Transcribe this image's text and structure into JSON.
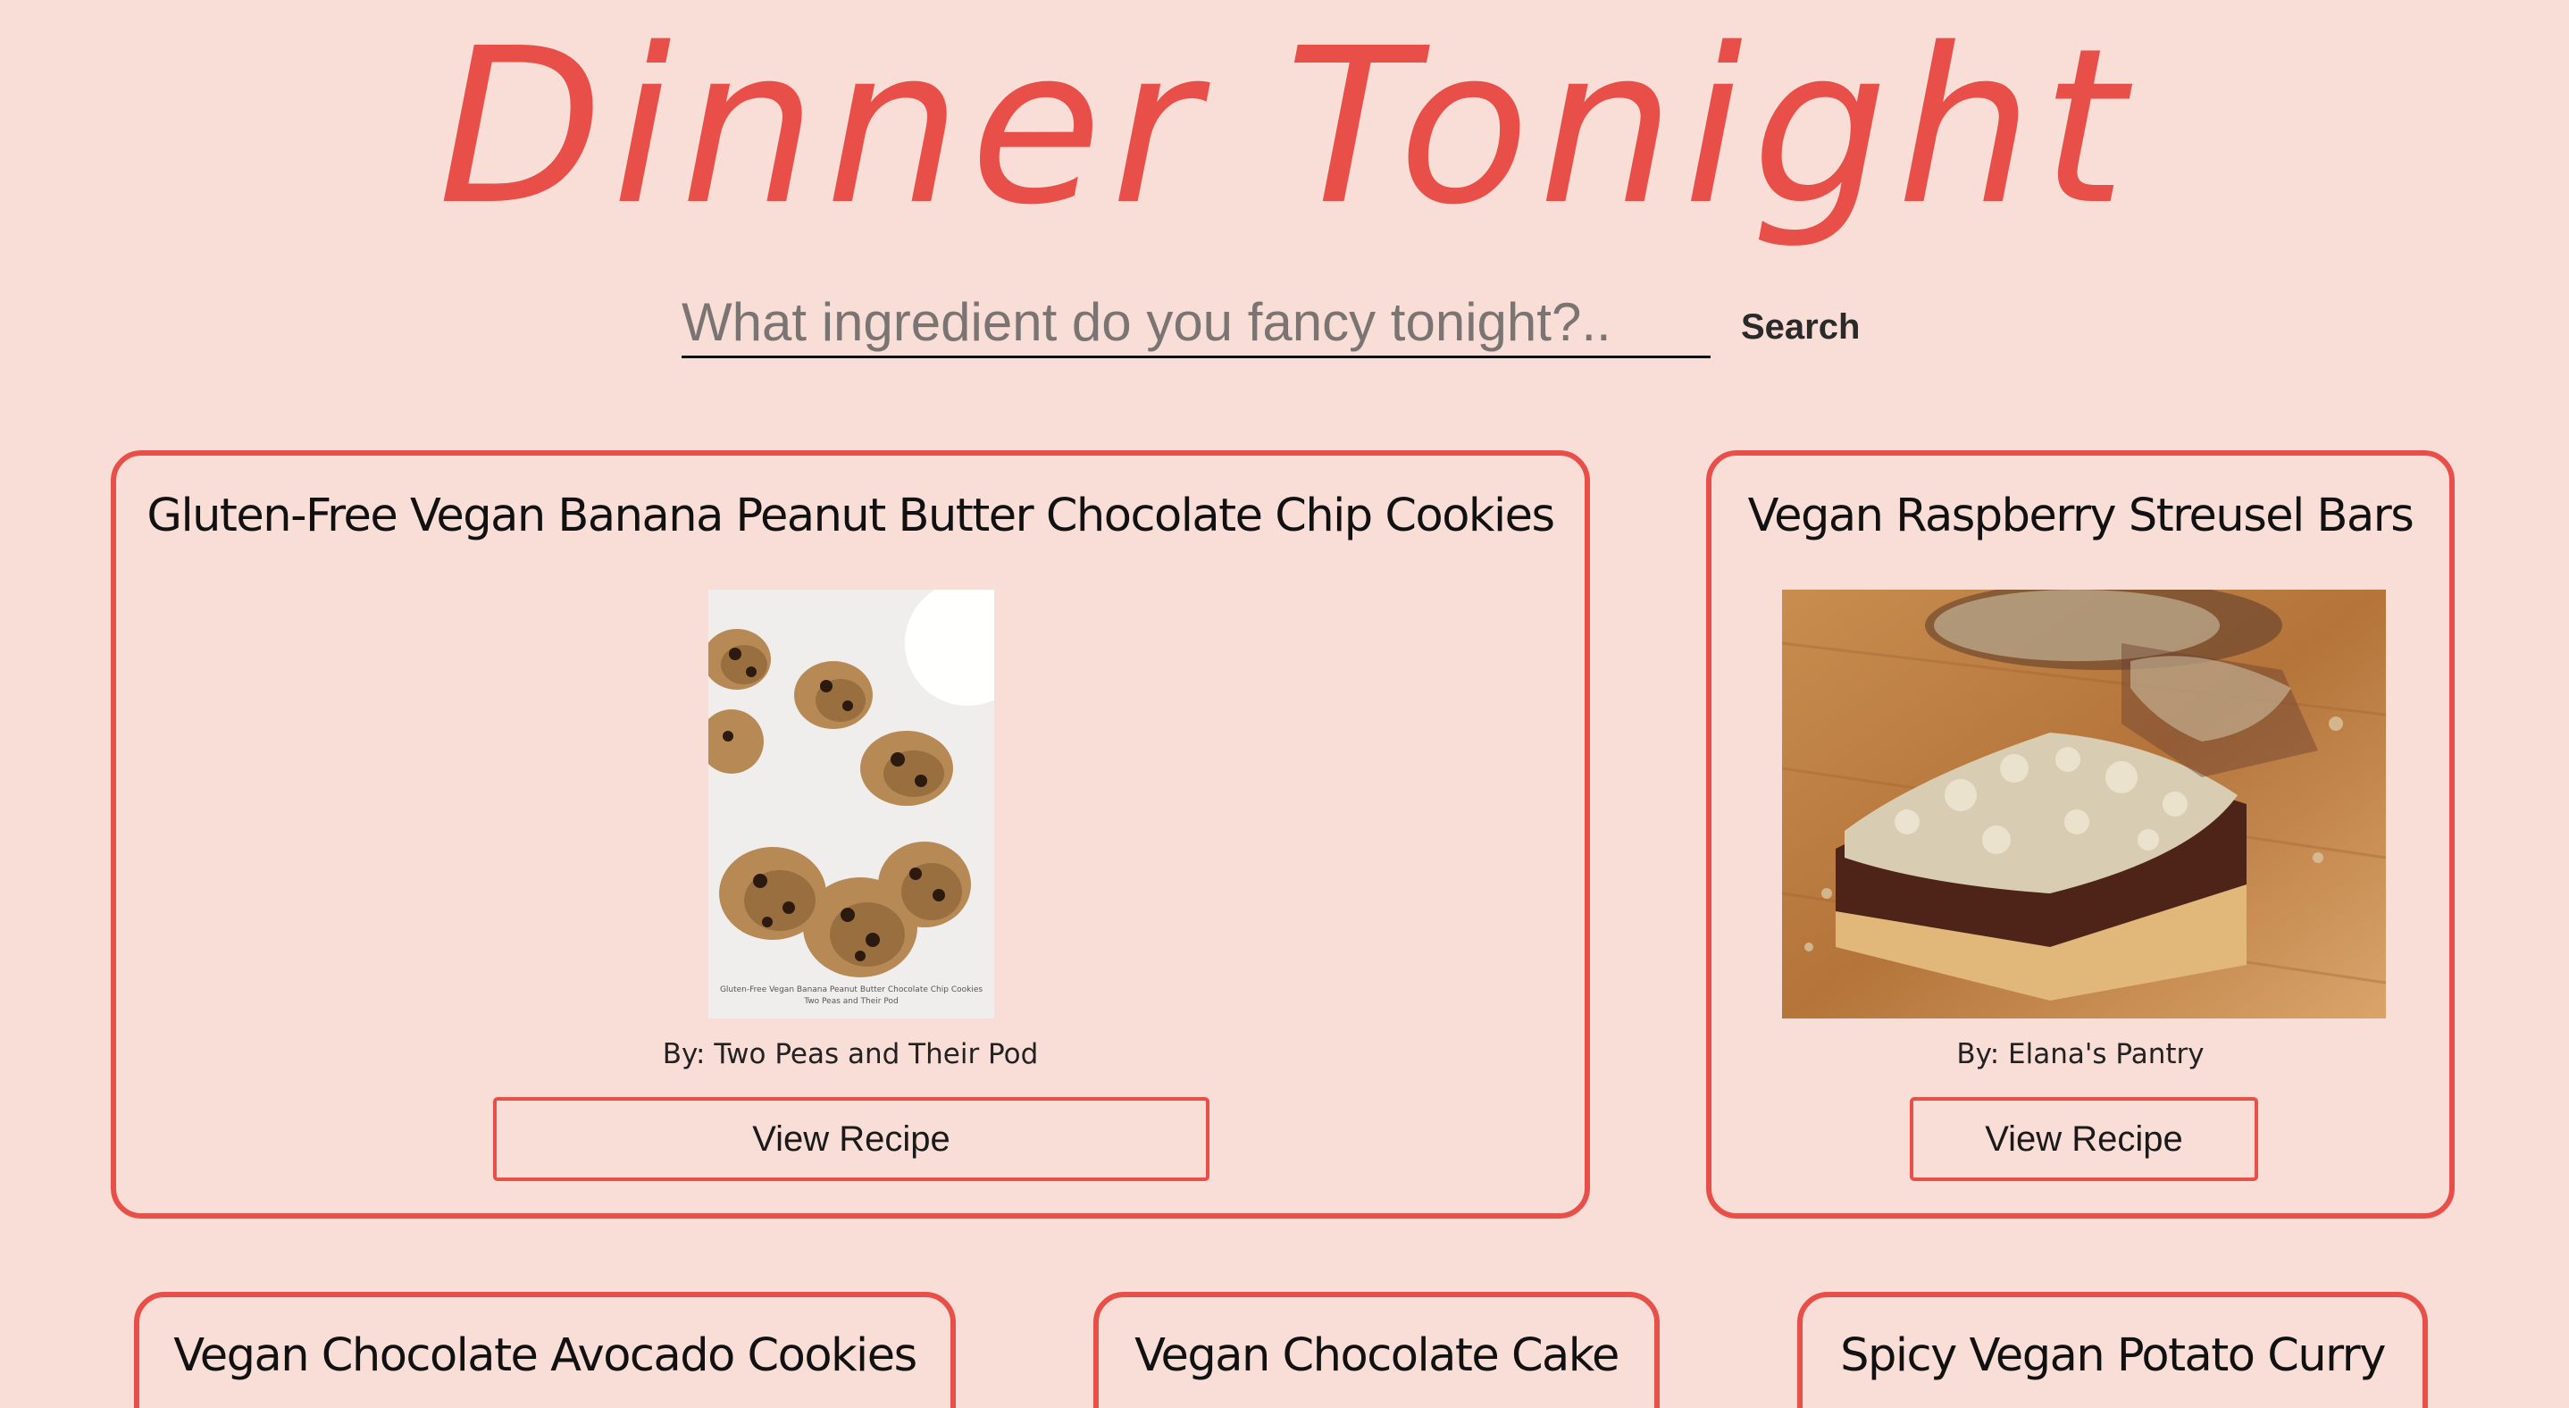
{
  "header": {
    "logo_text": "Dinner Tonight",
    "logo_color": "#e84f48"
  },
  "search": {
    "placeholder": "What ingredient do you fancy tonight?..",
    "value": "",
    "button_label": "Search"
  },
  "theme": {
    "background": "#f9ded7",
    "accent": "#e84f48"
  },
  "recipes": [
    {
      "title": "Gluten-Free Vegan Banana Peanut Butter Chocolate Chip Cookies",
      "author": "By: Two Peas and Their Pod",
      "button_label": "View Recipe",
      "image_caption_line1": "Gluten-Free Vegan Banana Peanut Butter Chocolate Chip Cookies",
      "image_caption_line2": "Two Peas and Their Pod"
    },
    {
      "title": "Vegan Raspberry Streusel Bars",
      "author": "By: Elana's Pantry",
      "button_label": "View Recipe"
    },
    {
      "title": "Vegan Chocolate Avocado Cookies"
    },
    {
      "title": "Vegan Chocolate Cake"
    },
    {
      "title": "Spicy Vegan Potato Curry"
    }
  ]
}
